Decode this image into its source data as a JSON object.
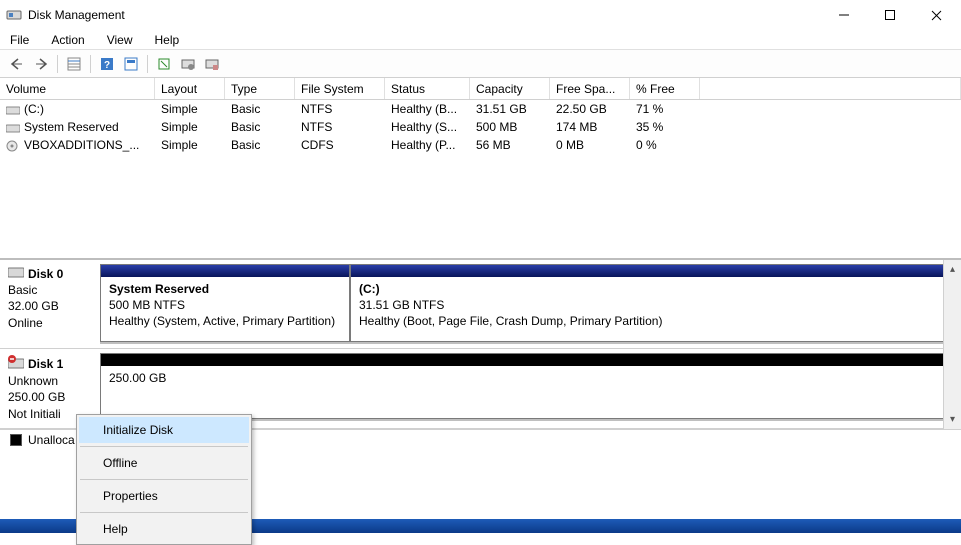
{
  "window": {
    "title": "Disk Management"
  },
  "menu": {
    "items": [
      "File",
      "Action",
      "View",
      "Help"
    ]
  },
  "columns": {
    "c0": "Volume",
    "c1": "Layout",
    "c2": "Type",
    "c3": "File System",
    "c4": "Status",
    "c5": "Capacity",
    "c6": "Free Spa...",
    "c7": "% Free"
  },
  "volumes": [
    {
      "name": "(C:)",
      "layout": "Simple",
      "type": "Basic",
      "fs": "NTFS",
      "status": "Healthy (B...",
      "capacity": "31.51 GB",
      "free": "22.50 GB",
      "pct": "71 %",
      "icon": "drive"
    },
    {
      "name": "System Reserved",
      "layout": "Simple",
      "type": "Basic",
      "fs": "NTFS",
      "status": "Healthy (S...",
      "capacity": "500 MB",
      "free": "174 MB",
      "pct": "35 %",
      "icon": "drive"
    },
    {
      "name": "VBOXADDITIONS_...",
      "layout": "Simple",
      "type": "Basic",
      "fs": "CDFS",
      "status": "Healthy (P...",
      "capacity": "56 MB",
      "free": "0 MB",
      "pct": "0 %",
      "icon": "disc"
    }
  ],
  "disks": [
    {
      "name": "Disk 0",
      "type": "Basic",
      "size": "32.00 GB",
      "status": "Online",
      "parts": [
        {
          "title": "System Reserved",
          "line2": "500 MB NTFS",
          "line3": "Healthy (System, Active, Primary Partition)",
          "color": "blue",
          "widthPx": 250
        },
        {
          "title": "(C:)",
          "line2": "31.51 GB NTFS",
          "line3": "Healthy (Boot, Page File, Crash Dump, Primary Partition)",
          "color": "blue",
          "widthPx": 574
        }
      ]
    },
    {
      "name": "Disk 1",
      "type": "Unknown",
      "size": "250.00 GB",
      "status": "Not Initialized",
      "statusShown": "Not Initiali",
      "parts": [
        {
          "title": "",
          "line2": "250.00 GB",
          "line3": "",
          "color": "black",
          "widthPx": 824
        }
      ]
    }
  ],
  "legend": {
    "label": "Unalloca"
  },
  "contextMenu": {
    "items": [
      "Initialize Disk",
      "Offline",
      "Properties",
      "Help"
    ],
    "highlight": 0
  }
}
